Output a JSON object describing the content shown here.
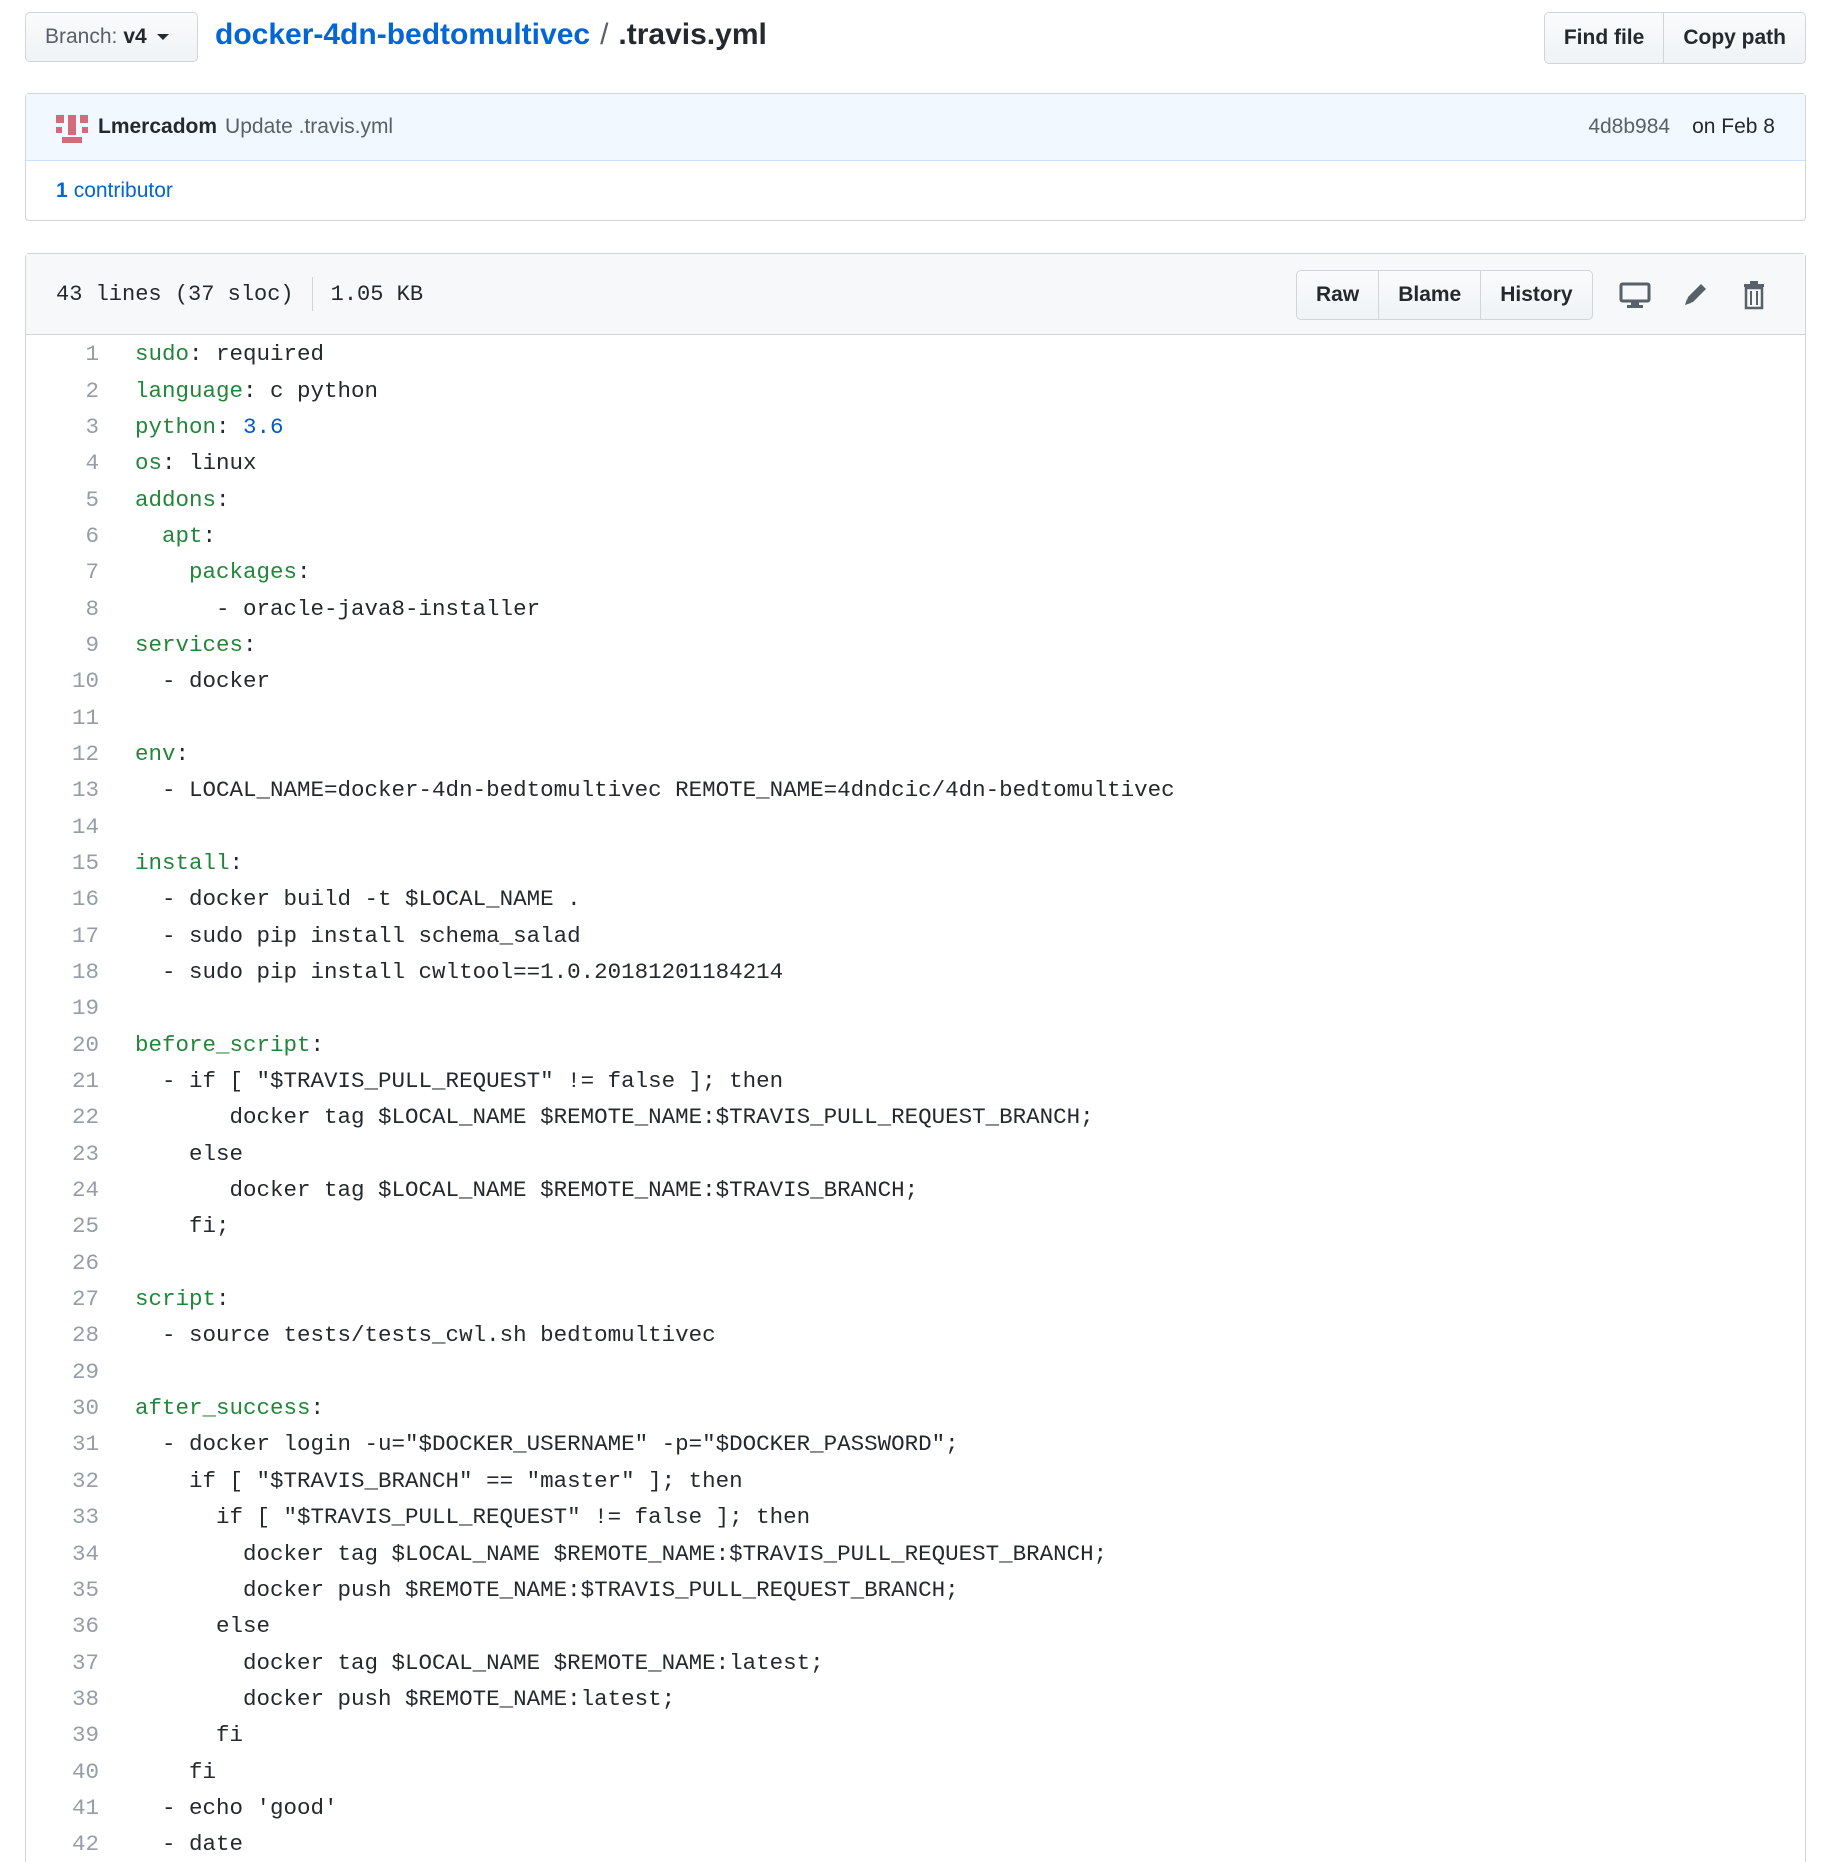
{
  "branch": {
    "label": "Branch:",
    "value": "v4"
  },
  "breadcrumb": {
    "repo": "docker-4dn-bedtomultivec",
    "separator": "/",
    "file": ".travis.yml"
  },
  "header_buttons": {
    "find_file": "Find file",
    "copy_path": "Copy path"
  },
  "commit": {
    "author": "Lmercadom",
    "message": "Update .travis.yml",
    "sha": "4d8b984",
    "date": "on Feb 8",
    "contributors_count": "1",
    "contributors_label": "contributor"
  },
  "file": {
    "lines_info": "43 lines (37 sloc)",
    "size": "1.05 KB",
    "actions": {
      "raw": "Raw",
      "blame": "Blame",
      "history": "History"
    }
  },
  "colors": {
    "link": "#0366d6",
    "yaml_key": "#22863a",
    "number": "#005cc5",
    "line_number": "#959da5"
  },
  "code_lines": [
    {
      "n": "1",
      "indent": "",
      "key": "sudo",
      "rest": ": required"
    },
    {
      "n": "2",
      "indent": "",
      "key": "language",
      "rest": ": c python"
    },
    {
      "n": "3",
      "indent": "",
      "key": "python",
      "rest": ": ",
      "num": "3.6"
    },
    {
      "n": "4",
      "indent": "",
      "key": "os",
      "rest": ": linux"
    },
    {
      "n": "5",
      "indent": "",
      "key": "addons",
      "rest": ":"
    },
    {
      "n": "6",
      "indent": "  ",
      "key": "apt",
      "rest": ":"
    },
    {
      "n": "7",
      "indent": "    ",
      "key": "packages",
      "rest": ":"
    },
    {
      "n": "8",
      "indent": "      ",
      "key": "",
      "rest": "- oracle-java8-installer"
    },
    {
      "n": "9",
      "indent": "",
      "key": "services",
      "rest": ":"
    },
    {
      "n": "10",
      "indent": "  ",
      "key": "",
      "rest": "- docker"
    },
    {
      "n": "11",
      "indent": "",
      "key": "",
      "rest": ""
    },
    {
      "n": "12",
      "indent": "",
      "key": "env",
      "rest": ":"
    },
    {
      "n": "13",
      "indent": "  ",
      "key": "",
      "rest": "- LOCAL_NAME=docker-4dn-bedtomultivec REMOTE_NAME=4dndcic/4dn-bedtomultivec"
    },
    {
      "n": "14",
      "indent": "",
      "key": "",
      "rest": ""
    },
    {
      "n": "15",
      "indent": "",
      "key": "install",
      "rest": ":"
    },
    {
      "n": "16",
      "indent": "  ",
      "key": "",
      "rest": "- docker build -t $LOCAL_NAME ."
    },
    {
      "n": "17",
      "indent": "  ",
      "key": "",
      "rest": "- sudo pip install schema_salad"
    },
    {
      "n": "18",
      "indent": "  ",
      "key": "",
      "rest": "- sudo pip install cwltool==1.0.20181201184214"
    },
    {
      "n": "19",
      "indent": "",
      "key": "",
      "rest": ""
    },
    {
      "n": "20",
      "indent": "",
      "key": "before_script",
      "rest": ":"
    },
    {
      "n": "21",
      "indent": "  ",
      "key": "",
      "rest": "- if [ \"$TRAVIS_PULL_REQUEST\" != false ]; then"
    },
    {
      "n": "22",
      "indent": "       ",
      "key": "",
      "rest": "docker tag $LOCAL_NAME $REMOTE_NAME:$TRAVIS_PULL_REQUEST_BRANCH;"
    },
    {
      "n": "23",
      "indent": "    ",
      "key": "",
      "rest": "else"
    },
    {
      "n": "24",
      "indent": "       ",
      "key": "",
      "rest": "docker tag $LOCAL_NAME $REMOTE_NAME:$TRAVIS_BRANCH;"
    },
    {
      "n": "25",
      "indent": "    ",
      "key": "",
      "rest": "fi;"
    },
    {
      "n": "26",
      "indent": "",
      "key": "",
      "rest": ""
    },
    {
      "n": "27",
      "indent": "",
      "key": "script",
      "rest": ":"
    },
    {
      "n": "28",
      "indent": "  ",
      "key": "",
      "rest": "- source tests/tests_cwl.sh bedtomultivec"
    },
    {
      "n": "29",
      "indent": "",
      "key": "",
      "rest": ""
    },
    {
      "n": "30",
      "indent": "",
      "key": "after_success",
      "rest": ":"
    },
    {
      "n": "31",
      "indent": "  ",
      "key": "",
      "rest": "- docker login -u=\"$DOCKER_USERNAME\" -p=\"$DOCKER_PASSWORD\";"
    },
    {
      "n": "32",
      "indent": "    ",
      "key": "",
      "rest": "if [ \"$TRAVIS_BRANCH\" == \"master\" ]; then"
    },
    {
      "n": "33",
      "indent": "      ",
      "key": "",
      "rest": "if [ \"$TRAVIS_PULL_REQUEST\" != false ]; then"
    },
    {
      "n": "34",
      "indent": "        ",
      "key": "",
      "rest": "docker tag $LOCAL_NAME $REMOTE_NAME:$TRAVIS_PULL_REQUEST_BRANCH;"
    },
    {
      "n": "35",
      "indent": "        ",
      "key": "",
      "rest": "docker push $REMOTE_NAME:$TRAVIS_PULL_REQUEST_BRANCH;"
    },
    {
      "n": "36",
      "indent": "      ",
      "key": "",
      "rest": "else"
    },
    {
      "n": "37",
      "indent": "        ",
      "key": "",
      "rest": "docker tag $LOCAL_NAME $REMOTE_NAME:latest;"
    },
    {
      "n": "38",
      "indent": "        ",
      "key": "",
      "rest": "docker push $REMOTE_NAME:latest;"
    },
    {
      "n": "39",
      "indent": "      ",
      "key": "",
      "rest": "fi"
    },
    {
      "n": "40",
      "indent": "    ",
      "key": "",
      "rest": "fi"
    },
    {
      "n": "41",
      "indent": "  ",
      "key": "",
      "rest": "- echo 'good'"
    },
    {
      "n": "42",
      "indent": "  ",
      "key": "",
      "rest": "- date"
    }
  ]
}
